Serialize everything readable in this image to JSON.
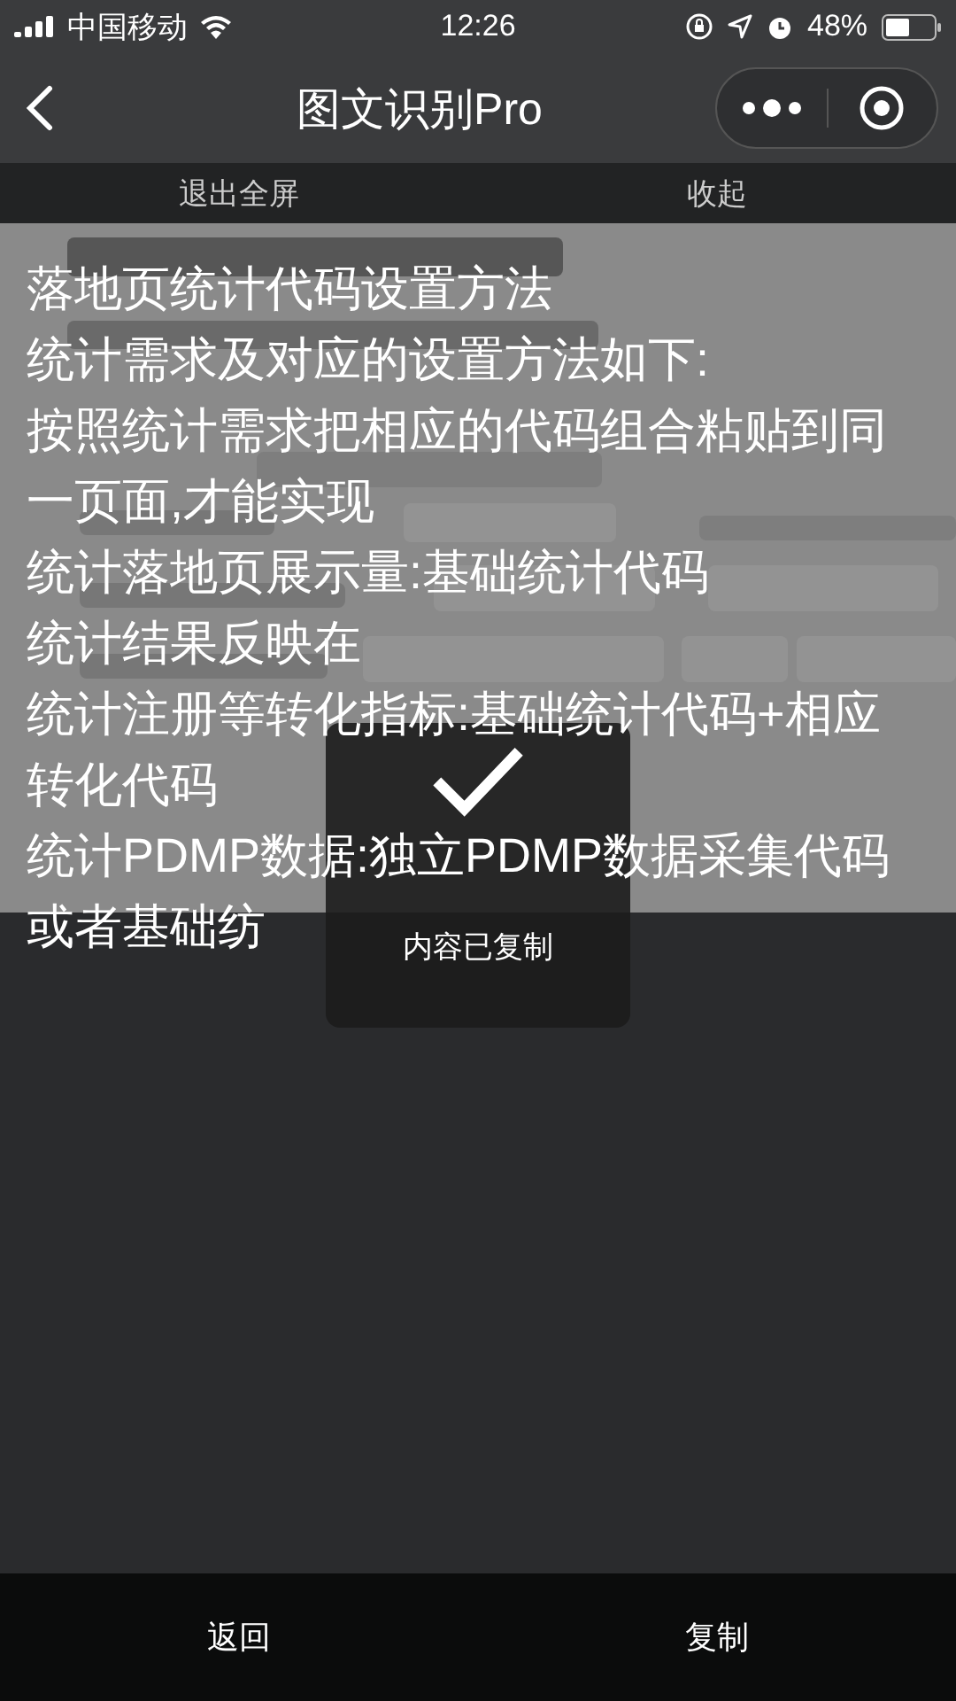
{
  "status_bar": {
    "carrier": "中国移动",
    "time": "12:26",
    "battery": "48%"
  },
  "nav": {
    "title": "图文识别Pro"
  },
  "toolbar": [
    "退出全屏",
    "收起"
  ],
  "recognized_text": [
    "落地页统计代码设置方法",
    "统计需求及对应的设置方法如下:",
    "按照统计需求把相应的代码组合粘贴到同",
    "一页面,才能实现",
    "统计落地页展示量:基础统计代码",
    "统计结果反映在",
    "统计注册等转化指标:基础统计代码+相应",
    "转化代码",
    "统计PDMP数据:独立PDMP数据采集代码",
    "或者基础纺"
  ],
  "toast": {
    "message": "内容已复制"
  },
  "bottom_bar": [
    "返回",
    "复制"
  ]
}
